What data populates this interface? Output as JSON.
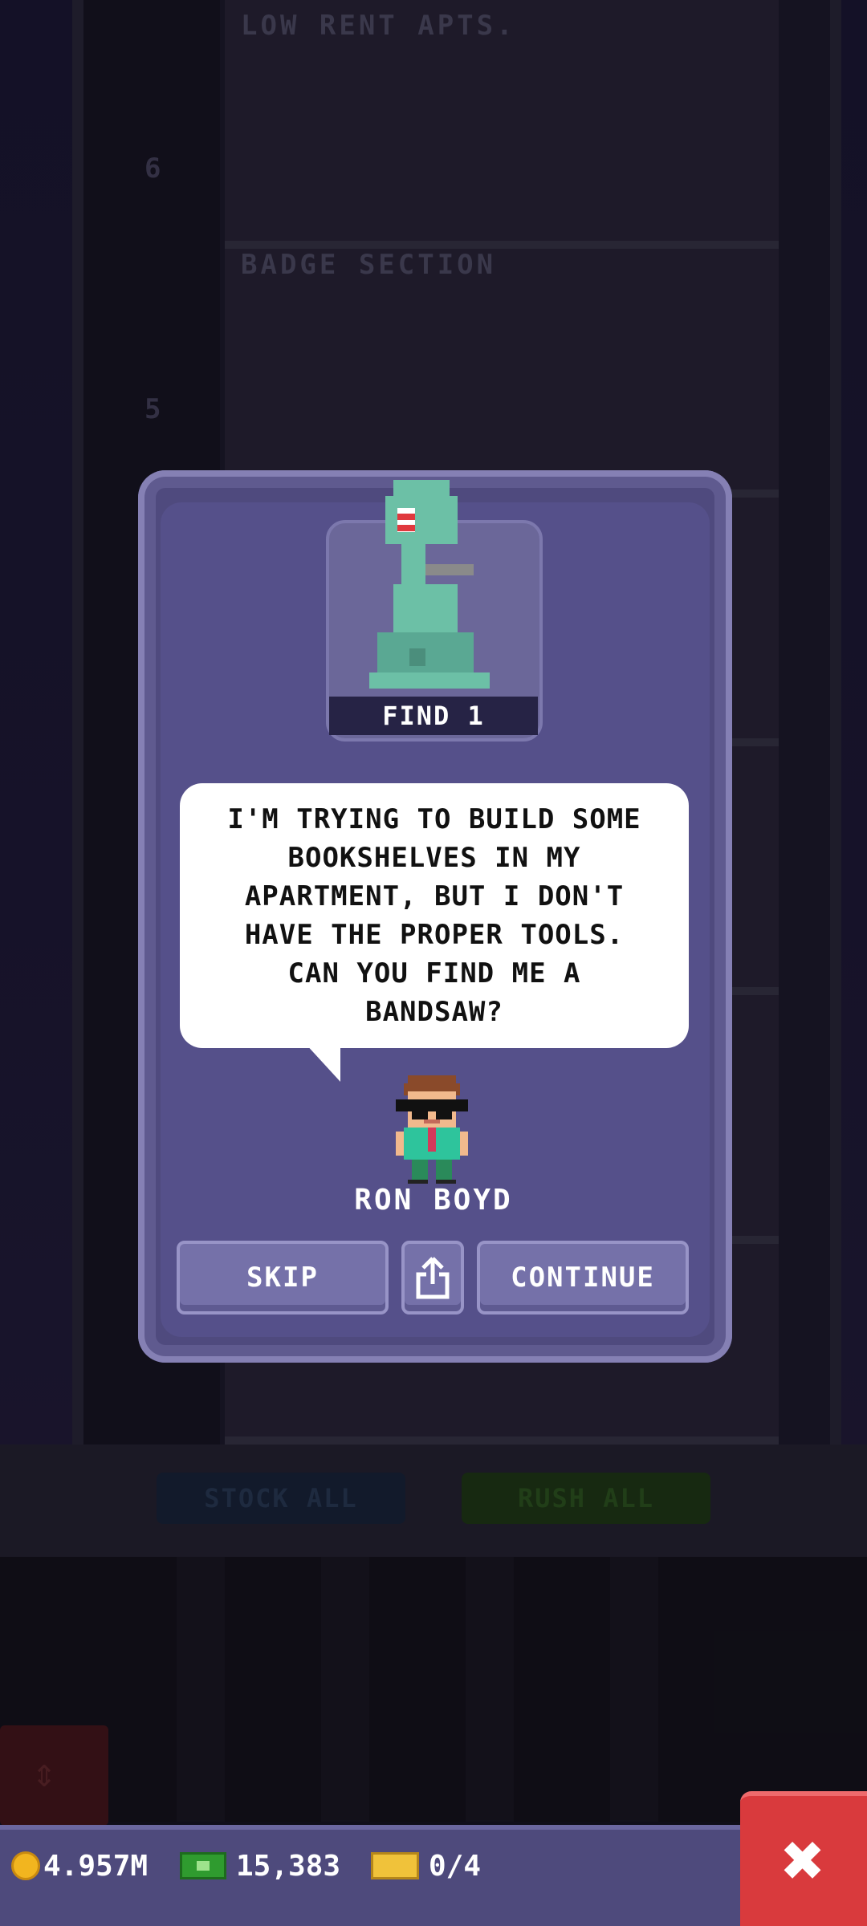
{
  "background": {
    "floors": [
      {
        "number": "6",
        "name": "LOW RENT APTS."
      },
      {
        "number": "5",
        "name": "BADGE SECTION"
      }
    ],
    "stock_all_label": "STOCK ALL",
    "rush_all_label": "RUSH ALL"
  },
  "quest": {
    "objective_label": "FIND 1",
    "trophy_icon": "bandsaw-icon",
    "dialogue_lines": [
      "I'M TRYING TO BUILD SOME",
      "BOOKSHELVES IN MY",
      "APARTMENT, BUT I DON'T",
      "HAVE THE PROPER TOOLS.",
      "CAN YOU FIND ME A",
      "BANDSAW?"
    ],
    "npc_name": "RON BOYD",
    "buttons": {
      "skip": "SKIP",
      "share_icon": "share-icon",
      "continue": "CONTINUE"
    }
  },
  "hud": {
    "coins": "4.957M",
    "bux": "15,383",
    "tickets": "0/4",
    "close_icon": "close-icon"
  },
  "colors": {
    "modal": "#4f4a7e",
    "button": "#7571a9",
    "close_button": "#d93a3d",
    "coin": "#f2b51f",
    "bux": "#2f9b2f"
  }
}
